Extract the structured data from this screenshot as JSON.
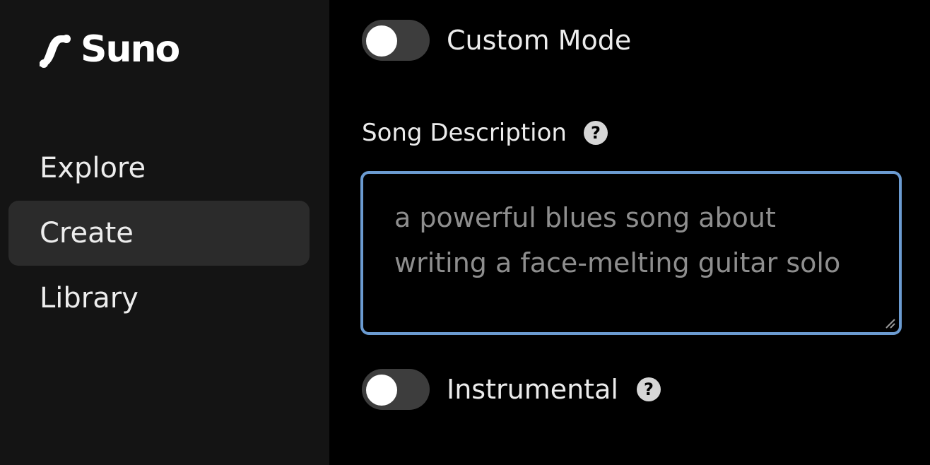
{
  "brand": {
    "name": "Suno",
    "logo_icon": "suno-wave-icon"
  },
  "sidebar": {
    "items": [
      {
        "label": "Explore",
        "active": false
      },
      {
        "label": "Create",
        "active": true
      },
      {
        "label": "Library",
        "active": false
      }
    ]
  },
  "custom_mode": {
    "label": "Custom Mode",
    "enabled": false
  },
  "song_description": {
    "label": "Song Description",
    "help_icon": "question-circle-icon",
    "value": "",
    "placeholder": "a powerful blues song about writing a face-melting guitar solo"
  },
  "instrumental": {
    "label": "Instrumental",
    "enabled": false,
    "help_icon": "question-circle-icon"
  },
  "colors": {
    "sidebar_bg": "#141414",
    "main_bg": "#000000",
    "active_nav_bg": "#2b2b2b",
    "focus_border": "#6b9bd1",
    "toggle_off": "#3d3d3d"
  }
}
